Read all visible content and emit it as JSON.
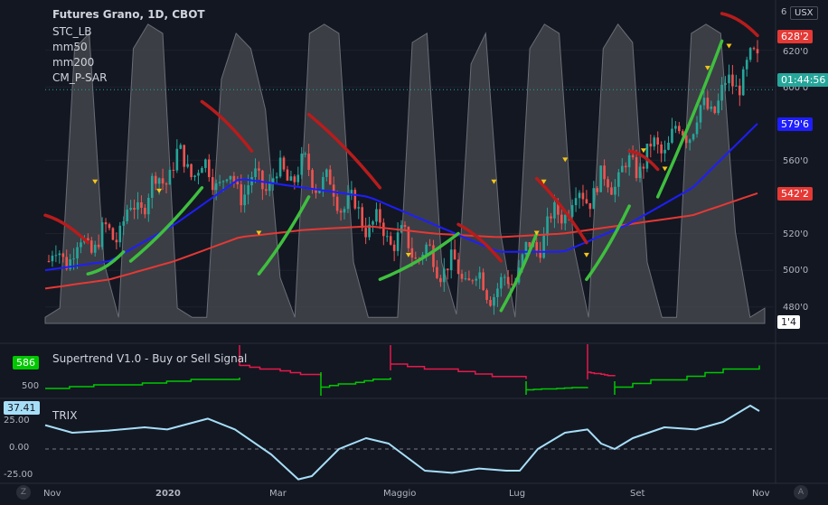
{
  "header": {
    "title": "Futures Grano, 1D, CBOT",
    "indicators": [
      "STC_LB",
      "mm50",
      "mm200",
      "CM_P-SAR"
    ],
    "currency": "USX",
    "top_tick": "6"
  },
  "price_axis": {
    "ticks": [
      "620'0",
      "600'0",
      "560'0",
      "520'0",
      "500'0",
      "480'0"
    ],
    "ticks_raw": [
      620,
      600,
      560,
      520,
      500,
      480
    ]
  },
  "price_badges": [
    {
      "text": "628'2",
      "bg": "#e53935",
      "value": 628.25
    },
    {
      "text": "01:44:56",
      "bg": "#26a69a",
      "value": 598.5
    },
    {
      "text": "579'6",
      "bg": "#1e1eff",
      "value": 579.75
    },
    {
      "text": "542'2",
      "bg": "#e53935",
      "value": 542.25
    },
    {
      "text": "1'4",
      "bg": "#ffffff",
      "fg": "#131722",
      "value": 473
    }
  ],
  "supertrend": {
    "label": "Supertrend V1.0 - Buy or Sell Signal",
    "badge": "586",
    "tick": "500"
  },
  "trix": {
    "label": "TRIX",
    "badge": "37.41",
    "ticks": [
      "25.00",
      "0.00",
      "-25.00"
    ]
  },
  "time_axis": [
    "Nov",
    "2020",
    "Mar",
    "Maggio",
    "Lug",
    "Set",
    "Nov"
  ],
  "corner_buttons": {
    "left": "Z",
    "right": "A"
  },
  "colors": {
    "bg": "#131722",
    "up": "#26a69a",
    "down": "#ef5350",
    "mm50": "#1e1eff",
    "mm200": "#e53935",
    "sar_up": "#3fbf3f",
    "sar_down": "#b71c1c",
    "stc": "#5a5d66",
    "trix": "#a6def7"
  },
  "chart_data": {
    "type": "line",
    "x": [
      "Nov",
      "2020",
      "Mar",
      "Maggio",
      "Lug",
      "Set",
      "Nov"
    ],
    "price_series": [
      {
        "name": "mm50",
        "values": [
          500,
          505,
          525,
          550,
          545,
          540,
          525,
          510,
          510,
          525,
          545,
          580
        ]
      },
      {
        "name": "mm200",
        "values": [
          490,
          495,
          505,
          518,
          522,
          524,
          520,
          518,
          520,
          525,
          530,
          542
        ]
      },
      {
        "name": "price",
        "values": [
          505,
          520,
          560,
          545,
          555,
          525,
          505,
          488,
          535,
          555,
          580,
          615
        ]
      }
    ],
    "trix_series": [
      {
        "name": "TRIX",
        "values": [
          20,
          15,
          22,
          -5,
          -20,
          5,
          -15,
          -10,
          15,
          0,
          20,
          37
        ]
      }
    ],
    "ylim": [
      470,
      640
    ],
    "trix_ylim": [
      -30,
      40
    ]
  }
}
